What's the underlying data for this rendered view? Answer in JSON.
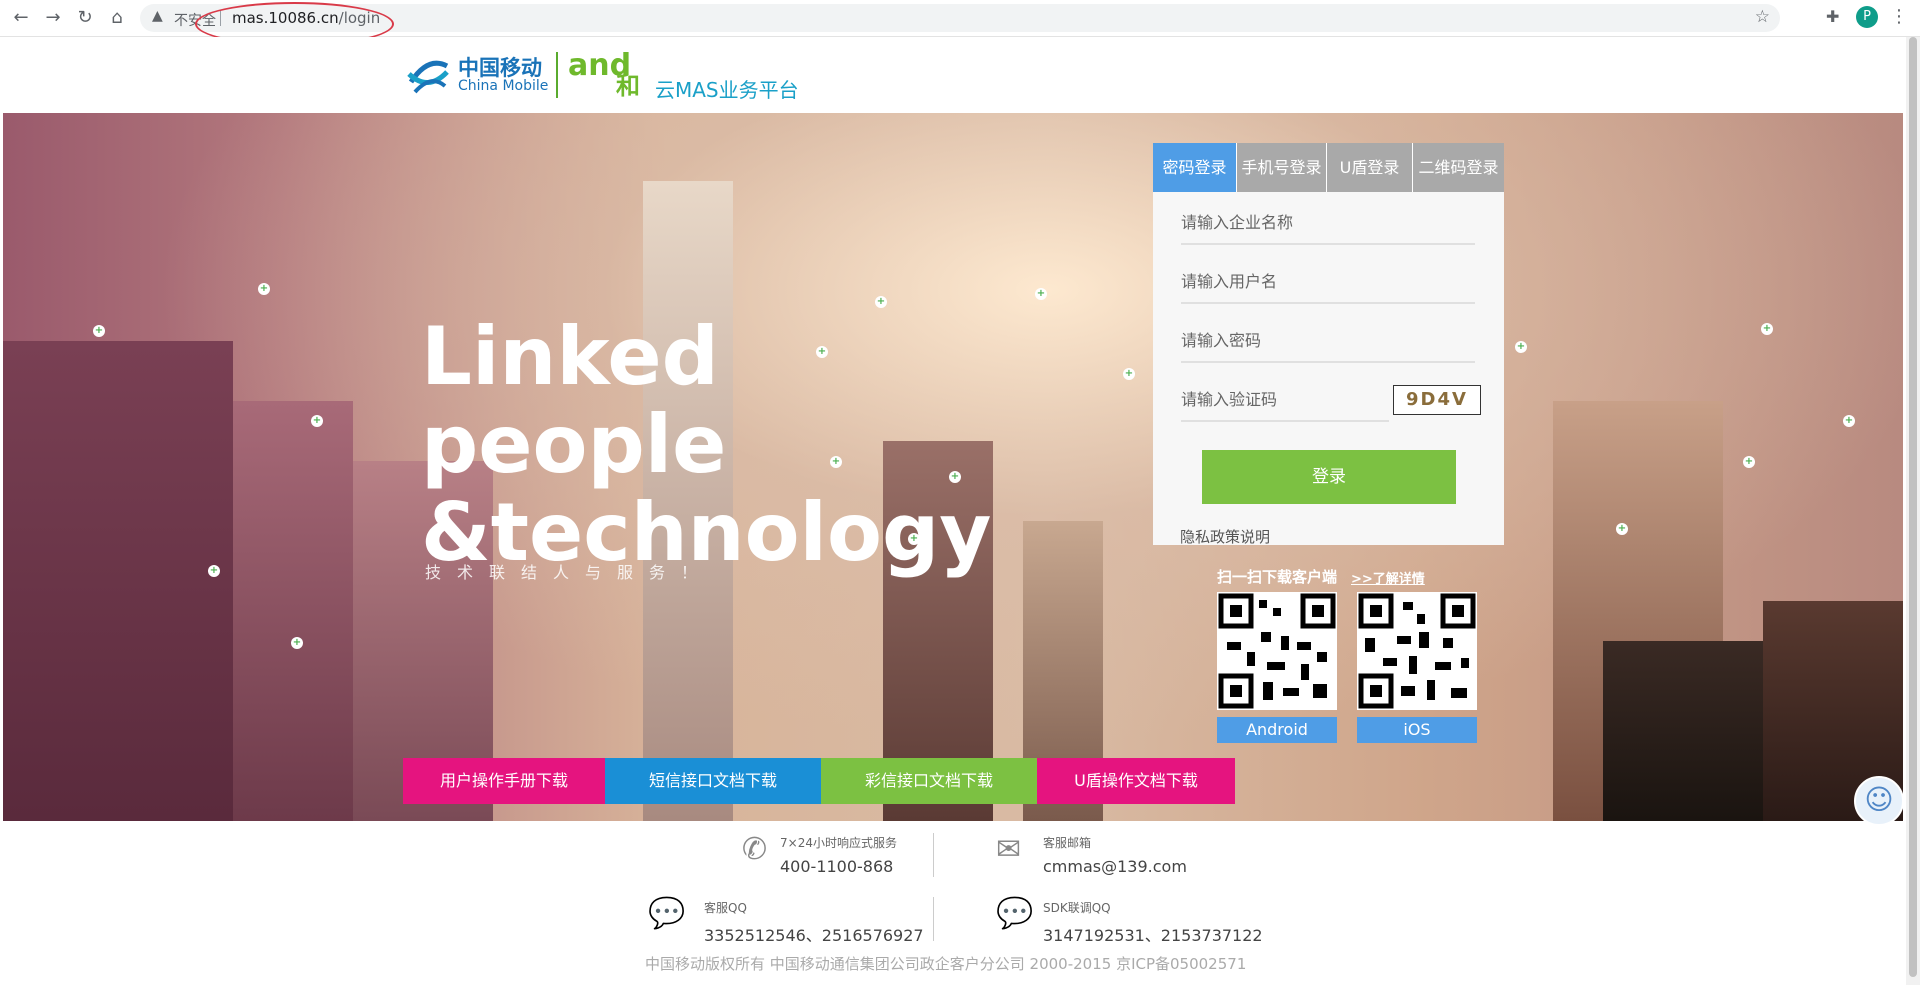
{
  "browser": {
    "insecure_label": "不安全",
    "url_host": "mas.10086.cn",
    "url_path": "/login",
    "profile_initial": "P"
  },
  "header": {
    "cm_cn": "中国移动",
    "cm_en": "China Mobile",
    "and_logo": "and",
    "he": "和",
    "platform": "云MAS业务平台"
  },
  "hero": {
    "title_line1": "Linked",
    "title_line2": "people",
    "title_line3": "&technology",
    "subtitle": "技术联结人与服务！"
  },
  "login": {
    "tabs": [
      "密码登录",
      "手机号登录",
      "U盾登录",
      "二维码登录"
    ],
    "active_tab": 0,
    "company_placeholder": "请输入企业名称",
    "username_placeholder": "请输入用户名",
    "password_placeholder": "请输入密码",
    "captcha_placeholder": "请输入验证码",
    "captcha_text": "9D4V",
    "submit_label": "登录",
    "privacy_link": "隐私政策说明"
  },
  "download": {
    "qr_title": "扫一扫下载客户端",
    "qr_more": ">>了解详情",
    "android_label": "Android",
    "ios_label": "iOS"
  },
  "doc_buttons": [
    {
      "label": "用户操作手册下载",
      "color": "#e5147f"
    },
    {
      "label": "短信接口文档下载",
      "color": "#1a8fd6"
    },
    {
      "label": "彩信接口文档下载",
      "color": "#7cc142"
    },
    {
      "label": "U盾操作文档下载",
      "color": "#e5147f"
    }
  ],
  "footer": {
    "hotline_label": "7×24小时响应式服务",
    "hotline_value": "400-1100-868",
    "email_label": "客服邮箱",
    "email_value": "cmmas@139.com",
    "qq_label": "客服QQ",
    "qq_value": "3352512546、2516576927",
    "sdk_label": "SDK联调QQ",
    "sdk_value": "3147192531、2153737122",
    "copyright": "中国移动版权所有 中国移动通信集团公司政企客户分公司 2000-2015 京ICP备05002571"
  },
  "colors": {
    "accent_blue": "#4f9de6",
    "login_green": "#7cc142",
    "tab_gray": "#a9a9a9"
  }
}
